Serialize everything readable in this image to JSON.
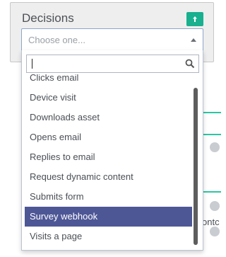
{
  "panel": {
    "title": "Decisions",
    "action_icon": "arrow-up-icon"
  },
  "select": {
    "placeholder": "Choose one..."
  },
  "dropdown": {
    "search": {
      "value": "",
      "icon": "search-icon"
    },
    "options": [
      {
        "label": "Clicks email"
      },
      {
        "label": "Device visit"
      },
      {
        "label": "Downloads asset"
      },
      {
        "label": "Opens email"
      },
      {
        "label": "Replies to email"
      },
      {
        "label": "Request dynamic content"
      },
      {
        "label": "Submits form"
      },
      {
        "label": "Survey webhook",
        "selected": true
      },
      {
        "label": "Visits a page"
      }
    ]
  },
  "background": {
    "edge_text": "ontc"
  },
  "colors": {
    "accent": "#18b08f",
    "selected": "#4e5796",
    "connector": "#2cc6a3"
  }
}
